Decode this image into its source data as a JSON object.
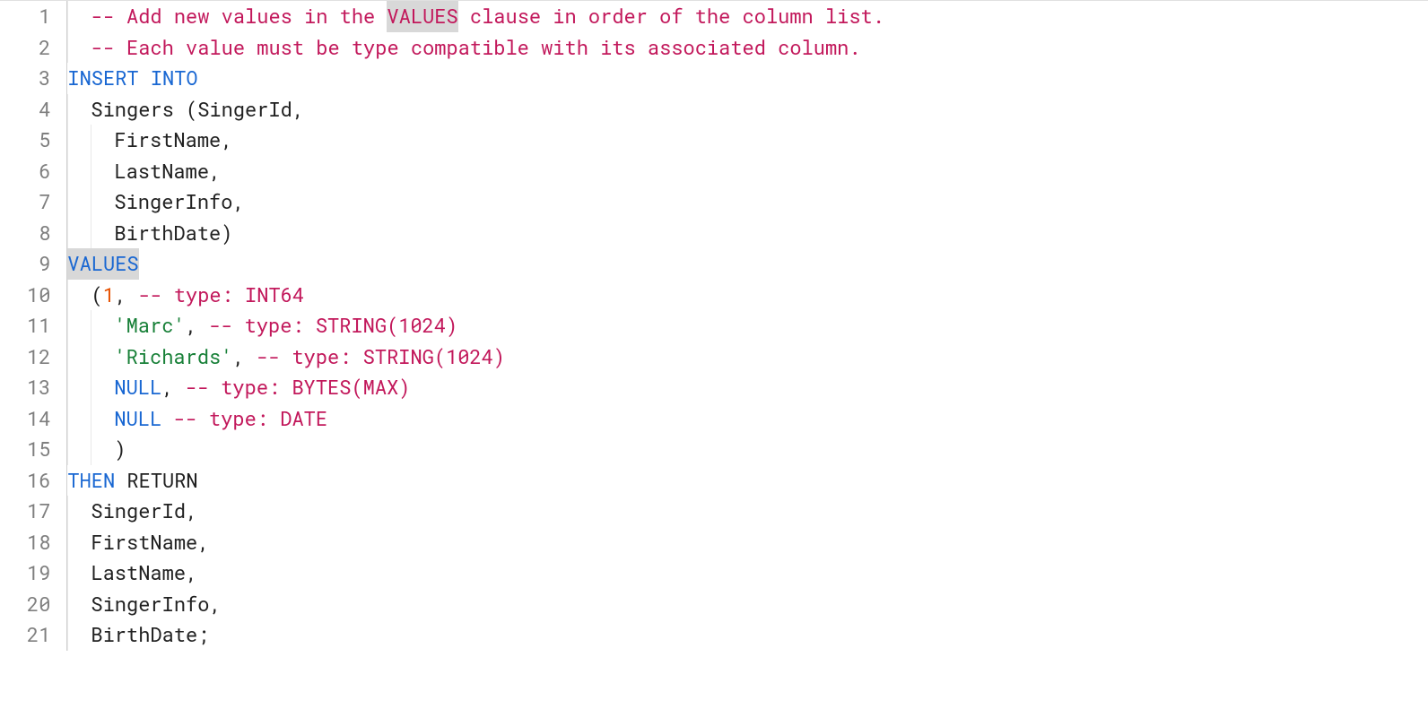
{
  "lines": {
    "n1": "1",
    "n2": "2",
    "n3": "3",
    "n4": "4",
    "n5": "5",
    "n6": "6",
    "n7": "7",
    "n8": "8",
    "n9": "9",
    "n10": "10",
    "n11": "11",
    "n12": "12",
    "n13": "13",
    "n14": "14",
    "n15": "15",
    "n16": "16",
    "n17": "17",
    "n18": "18",
    "n19": "19",
    "n20": "20",
    "n21": "21"
  },
  "code": {
    "c1a": "-- Add new values in the ",
    "c1b": "VALUES",
    "c1c": " clause in order of the column list.",
    "c2": "-- Each value must be type compatible with its associated column.",
    "l3": "INSERT INTO",
    "l4a": "Singers ",
    "l4b": "(",
    "l4c": "SingerId",
    "l4d": ",",
    "l5a": "FirstName",
    "l5b": ",",
    "l6a": "LastName",
    "l6b": ",",
    "l7a": "SingerInfo",
    "l7b": ",",
    "l8a": "BirthDate",
    "l8b": ")",
    "l9": "VALUES",
    "l10a": "(",
    "l10b": "1",
    "l10c": ", ",
    "l10d": "-- type: INT64",
    "l11a": "'Marc'",
    "l11b": ", ",
    "l11c": "-- type: STRING(1024)",
    "l12a": "'Richards'",
    "l12b": ", ",
    "l12c": "-- type: STRING(1024)",
    "l13a": "NULL",
    "l13b": ", ",
    "l13c": "-- type: BYTES(MAX)",
    "l14a": "NULL",
    "l14b": " ",
    "l14c": "-- type: DATE",
    "l15": ")",
    "l16a": "THEN",
    "l16b": " RETURN",
    "l17a": "SingerId",
    "l17b": ",",
    "l18a": "FirstName",
    "l18b": ",",
    "l19a": "LastName",
    "l19b": ",",
    "l20a": "SingerInfo",
    "l20b": ",",
    "l21a": "BirthDate",
    "l21b": ";"
  }
}
